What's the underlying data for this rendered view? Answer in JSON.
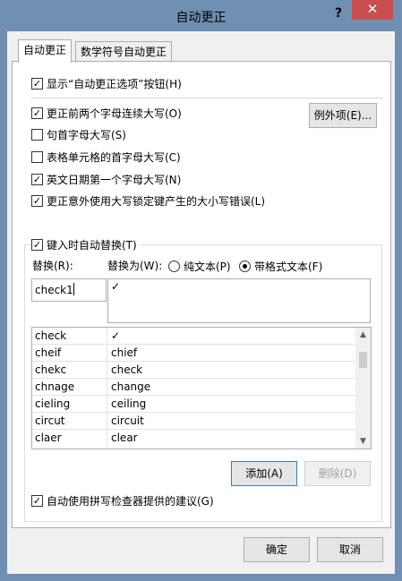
{
  "window": {
    "title": "自动更正",
    "help": "?",
    "close": "✕"
  },
  "tabs": [
    {
      "label": "自动更正",
      "active": true
    },
    {
      "label": "数学符号自动更正",
      "active": false
    }
  ],
  "options": {
    "show_buttons": {
      "label": "显示“自动更正选项”按钮(H)",
      "checked": true
    },
    "two_initial_caps": {
      "label": "更正前两个字母连续大写(O)",
      "checked": true
    },
    "sentence_caps": {
      "label": "句首字母大写(S)",
      "checked": false
    },
    "table_cell_caps": {
      "label": "表格单元格的首字母大写(C)",
      "checked": false
    },
    "day_names": {
      "label": "英文日期第一个字母大写(N)",
      "checked": true
    },
    "caps_lock": {
      "label": "更正意外使用大写锁定键产生的大小写错误(L)",
      "checked": true
    },
    "replace_as_type": {
      "label": "键入时自动替换(T)",
      "checked": true
    },
    "use_spell_checker": {
      "label": "自动使用拼写检查器提供的建议(G)",
      "checked": true
    }
  },
  "exceptions_button": "例外项(E)...",
  "replace_label": "替换(R):",
  "with_label": "替换为(W):",
  "radio_plain": {
    "label": "纯文本(P)",
    "checked": false
  },
  "radio_formatted": {
    "label": "带格式文本(F)",
    "checked": true
  },
  "replace_value": "check1",
  "with_value": "✓",
  "entries": [
    {
      "replace": "check",
      "with": "✓"
    },
    {
      "replace": "cheif",
      "with": "chief"
    },
    {
      "replace": "chekc",
      "with": "check"
    },
    {
      "replace": "chnage",
      "with": "change"
    },
    {
      "replace": "cieling",
      "with": "ceiling"
    },
    {
      "replace": "circut",
      "with": "circuit"
    },
    {
      "replace": "claer",
      "with": "clear"
    }
  ],
  "add_button": "添加(A)",
  "delete_button": "删除(D)",
  "ok_button": "确定",
  "cancel_button": "取消",
  "scroll_up": "▲",
  "scroll_down": "▼",
  "colors": {
    "titlebar": "#6f8fb3",
    "close": "#c74f50"
  }
}
